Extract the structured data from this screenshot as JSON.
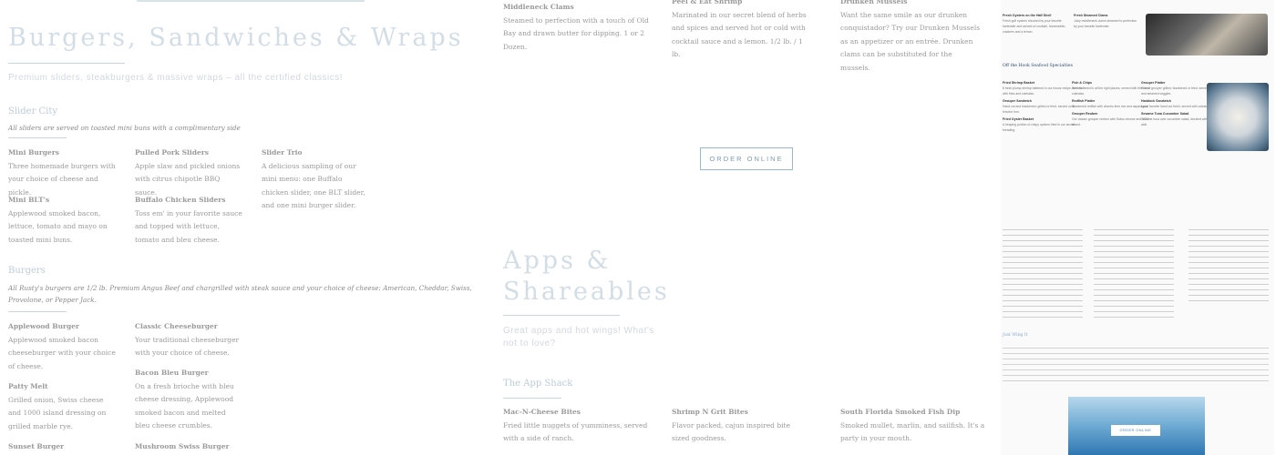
{
  "burgers_section": {
    "title": "Burgers, Sandwiches & Wraps",
    "subtitle": "Premium sliders, steakburgers & massive wraps – all the certified classics!",
    "slider_city": {
      "heading": "Slider City",
      "note": "All sliders are served on toasted mini buns with a complimentary side",
      "items": [
        {
          "name": "Mini Burgers",
          "desc": "Three homemade burgers with your choice of cheese and pickle."
        },
        {
          "name": "Pulled Pork Sliders",
          "desc": "Apple slaw and pickled onions with citrus chipotle BBQ sauce."
        },
        {
          "name": "Slider Trio",
          "desc": "A delicious sampling of our mini menu: one Buffalo chicken slider, one BLT slider, and one mini burger slider."
        },
        {
          "name": "Mini BLT's",
          "desc": "Applewood smoked bacon, lettuce, tomato and mayo on toasted mini buns."
        },
        {
          "name": "Buffalo Chicken Sliders",
          "desc": "Toss em' in your favorite sauce and topped with lettuce, tomato and bleu cheese."
        }
      ]
    },
    "burgers": {
      "heading": "Burgers",
      "note": "All Rusty's burgers are 1/2 lb. Premium Angus Beef and chargrilled with steak sauce and your choice of cheese: American, Cheddar, Swiss, Provolone, or Pepper Jack.",
      "items": [
        {
          "name": "Applewood Burger",
          "desc": "Applewood smoked bacon cheeseburger with your choice of cheese."
        },
        {
          "name": "Classic Cheeseburger",
          "desc": "Your traditional cheeseburger with your choice of cheese."
        },
        {
          "name": "Patty Melt",
          "desc": "Grilled onion, Swiss cheese and 1000 island dressing on grilled marble rye."
        },
        {
          "name": "Bacon Bleu Burger",
          "desc": "On a fresh brioche with bleu cheese dressing, Applewood smoked bacon and melted bleu cheese crumbles."
        },
        {
          "name": "Sunset Burger",
          "desc": ""
        },
        {
          "name": "Mushroom Swiss Burger",
          "desc": ""
        }
      ]
    }
  },
  "seafood_top": {
    "items": [
      {
        "name": "Middleneck Clams",
        "desc": "Steamed to perfection with a touch of Old Bay and drawn butter for dipping. 1 or 2 Dozen."
      },
      {
        "name": "Peel & Eat Shrimp",
        "desc": "Marinated in our secret blend of herbs and spices and served hot or cold with cocktail sauce and a lemon. 1/2 lb. / 1 lb."
      },
      {
        "name": "Drunken Mussels",
        "desc": "Want the same smile as our drunken conquistador? Try our Drunken Mussels as an appetizer or an entrée. Drunken clams can be substituted for the mussels."
      }
    ],
    "order_button": "ORDER ONLINE"
  },
  "apps_section": {
    "title": "Apps & Shareables",
    "subtitle": "Great apps and hot wings! What's not to love?",
    "subheading": "The App Shack",
    "items": [
      {
        "name": "Mac-N-Cheese Bites",
        "desc": "Fried little nuggets of yumminess, served with a side of ranch."
      },
      {
        "name": "Shrimp N Grit Bites",
        "desc": "Flavor packed, cajun inspired bite sized goodness."
      },
      {
        "name": "South Florida Smoked Fish Dip",
        "desc": "Smoked mullet, marlin, and sailfish. It's a party in your mouth."
      }
    ]
  },
  "menu_preview": {
    "top_cols": [
      {
        "name": "Fresh Oysters on the Half Shell",
        "desc": "Fresh gulf oysters shucked by your favorite bartender and served w/ cocktail, horseradish, crackers and a lemon."
      },
      {
        "name": "Fresh Steamed Clams",
        "desc": "Juicy middleneck clams steamed to perfection by your favorite bartender."
      }
    ],
    "heading": "Off the Hook Seafood Specialties",
    "heading2": "Just Wing It",
    "cols": [
      {
        "name": "Fried Shrimp Basket",
        "desc": "8 fresh plump shrimp battered in our house recipe, served with fries and coleslaw."
      },
      {
        "name": "Fish & Chips",
        "desc": "Beer battered in all the right places, served with fries and coleslaw."
      },
      {
        "name": "Grouper Platter",
        "desc": "Filet of grouper grilled, blackened or fried, served with rice and steamed veggies."
      },
      {
        "name": "Grouper Sandwich",
        "desc": "Hand cut and blackened, grilled or fried, served on a brioche bun."
      },
      {
        "name": "Redfish Platter",
        "desc": "Blackened redfish with cilantro lime rice and asparagus."
      },
      {
        "name": "Haddock Sandwich",
        "desc": "Local favorite hand cut fresh, served with coleslaw."
      },
      {
        "name": "Fried Oyster Basket",
        "desc": "A heaping portion of crispy oysters fried in our secret breading."
      },
      {
        "name": "Grouper Reuben",
        "desc": "Our classic grouper reuben with Swiss cheese and 1000 island."
      },
      {
        "name": "Sesame Tuna Cucumber Salad",
        "desc": "Sesame tuna over cucumber salad, drizzled with sriracha aioli."
      }
    ],
    "order_button": "ORDER ONLINE"
  }
}
